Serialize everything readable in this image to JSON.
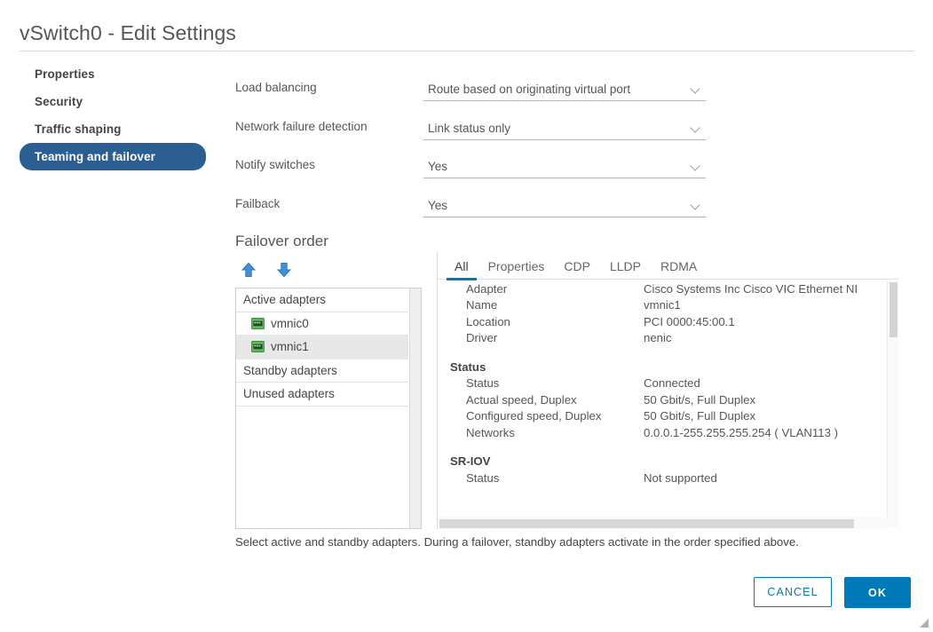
{
  "window": {
    "title": "vSwitch0 - Edit Settings"
  },
  "sidebar": {
    "items": [
      {
        "label": "Properties",
        "active": false
      },
      {
        "label": "Security",
        "active": false
      },
      {
        "label": "Traffic shaping",
        "active": false
      },
      {
        "label": "Teaming and failover",
        "active": true
      }
    ]
  },
  "form": {
    "rows": [
      {
        "label": "Load balancing",
        "value": "Route based on originating virtual port"
      },
      {
        "label": "Network failure detection",
        "value": "Link status only"
      },
      {
        "label": "Notify switches",
        "value": "Yes"
      },
      {
        "label": "Failback",
        "value": "Yes"
      }
    ]
  },
  "failover": {
    "title": "Failover order",
    "move_up_label": "Move up",
    "move_down_label": "Move down",
    "groups": [
      {
        "label": "Active adapters",
        "adapters": [
          {
            "name": "vmnic0",
            "selected": false
          },
          {
            "name": "vmnic1",
            "selected": true
          }
        ]
      },
      {
        "label": "Standby adapters",
        "adapters": []
      },
      {
        "label": "Unused adapters",
        "adapters": []
      }
    ]
  },
  "detail": {
    "tabs": [
      {
        "label": "All",
        "active": true
      },
      {
        "label": "Properties",
        "active": false
      },
      {
        "label": "CDP",
        "active": false
      },
      {
        "label": "LLDP",
        "active": false
      },
      {
        "label": "RDMA",
        "active": false
      }
    ],
    "rows": [
      {
        "key": "Adapter",
        "value": "Cisco Systems Inc Cisco VIC Ethernet NI",
        "section": false
      },
      {
        "key": "Name",
        "value": "vmnic1",
        "section": false
      },
      {
        "key": "Location",
        "value": "PCI 0000:45:00.1",
        "section": false
      },
      {
        "key": "Driver",
        "value": "nenic",
        "section": false
      },
      {
        "key": "Status",
        "value": "",
        "section": true
      },
      {
        "key": "Status",
        "value": "Connected",
        "section": false
      },
      {
        "key": "Actual speed, Duplex",
        "value": "50 Gbit/s, Full Duplex",
        "section": false
      },
      {
        "key": "Configured speed, Duplex",
        "value": "50 Gbit/s, Full Duplex",
        "section": false
      },
      {
        "key": "Networks",
        "value": "0.0.0.1-255.255.255.254 ( VLAN113 )",
        "section": false
      },
      {
        "key": "SR-IOV",
        "value": "",
        "section": true
      },
      {
        "key": "Status",
        "value": "Not supported",
        "section": false
      }
    ]
  },
  "hint": "Select active and standby adapters. During a failover, standby adapters activate in the order specified above.",
  "footer": {
    "cancel_label": "CANCEL",
    "ok_label": "OK"
  },
  "colors": {
    "accent": "#0079b8",
    "sidebar_active": "#2b5e91",
    "nic_green": "#4ca64c",
    "text": "#565656"
  }
}
